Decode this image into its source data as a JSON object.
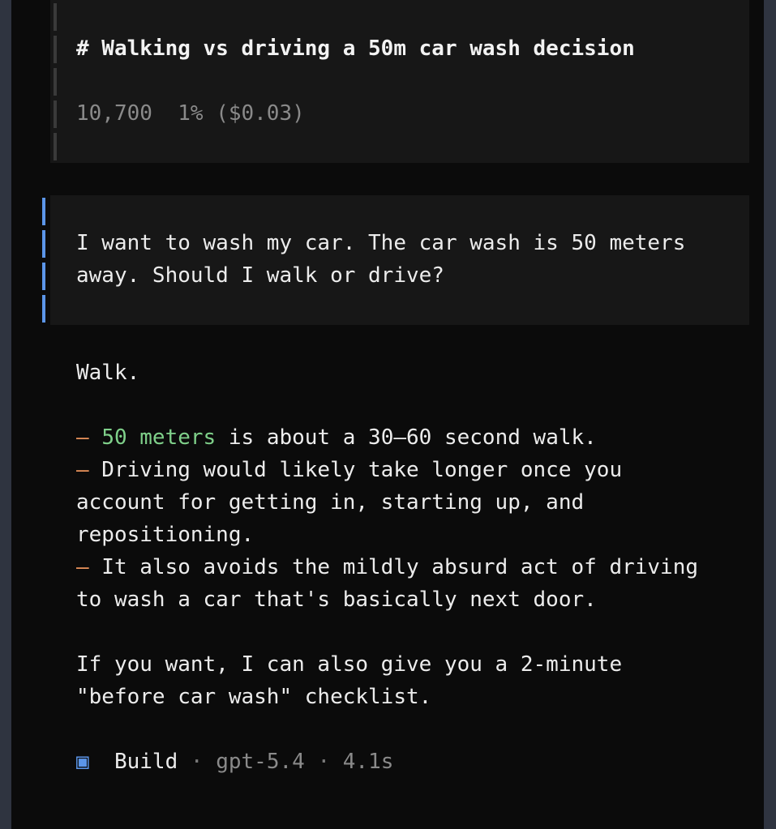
{
  "session": {
    "title": "# Walking vs driving a 50m car wash decision",
    "tokens": "10,700",
    "usage": "1% ($0.03)"
  },
  "user_message": {
    "lines": [
      "I want to wash my car. The car wash is 50 meters",
      "away. Should I walk or drive?"
    ]
  },
  "assistant_message": {
    "intro": "Walk.",
    "bullet_marker": "–",
    "bullet1": {
      "highlight": "50 meters",
      "rest": " is about a 30–60 second walk."
    },
    "bullet2": {
      "lines": [
        " Driving would likely take longer once you",
        "account for getting in, starting up, and",
        "repositioning."
      ]
    },
    "bullet3": {
      "lines": [
        " It also avoids the mildly absurd act of driving",
        "to wash a car that's basically next door."
      ]
    },
    "outro": [
      "If you want, I can also give you a 2-minute",
      "\"before car wash\" checklist."
    ]
  },
  "footer": {
    "icon": "square-icon",
    "icon_glyph": "▣",
    "agent": "Build",
    "separator": "·",
    "model": "gpt-5.4",
    "duration": "4.1s"
  },
  "colors": {
    "background": "#0b0b0b",
    "block": "#171717",
    "accent_blue": "#5b95e8",
    "accent_orange": "#e8915a",
    "accent_green": "#7fd08a"
  }
}
